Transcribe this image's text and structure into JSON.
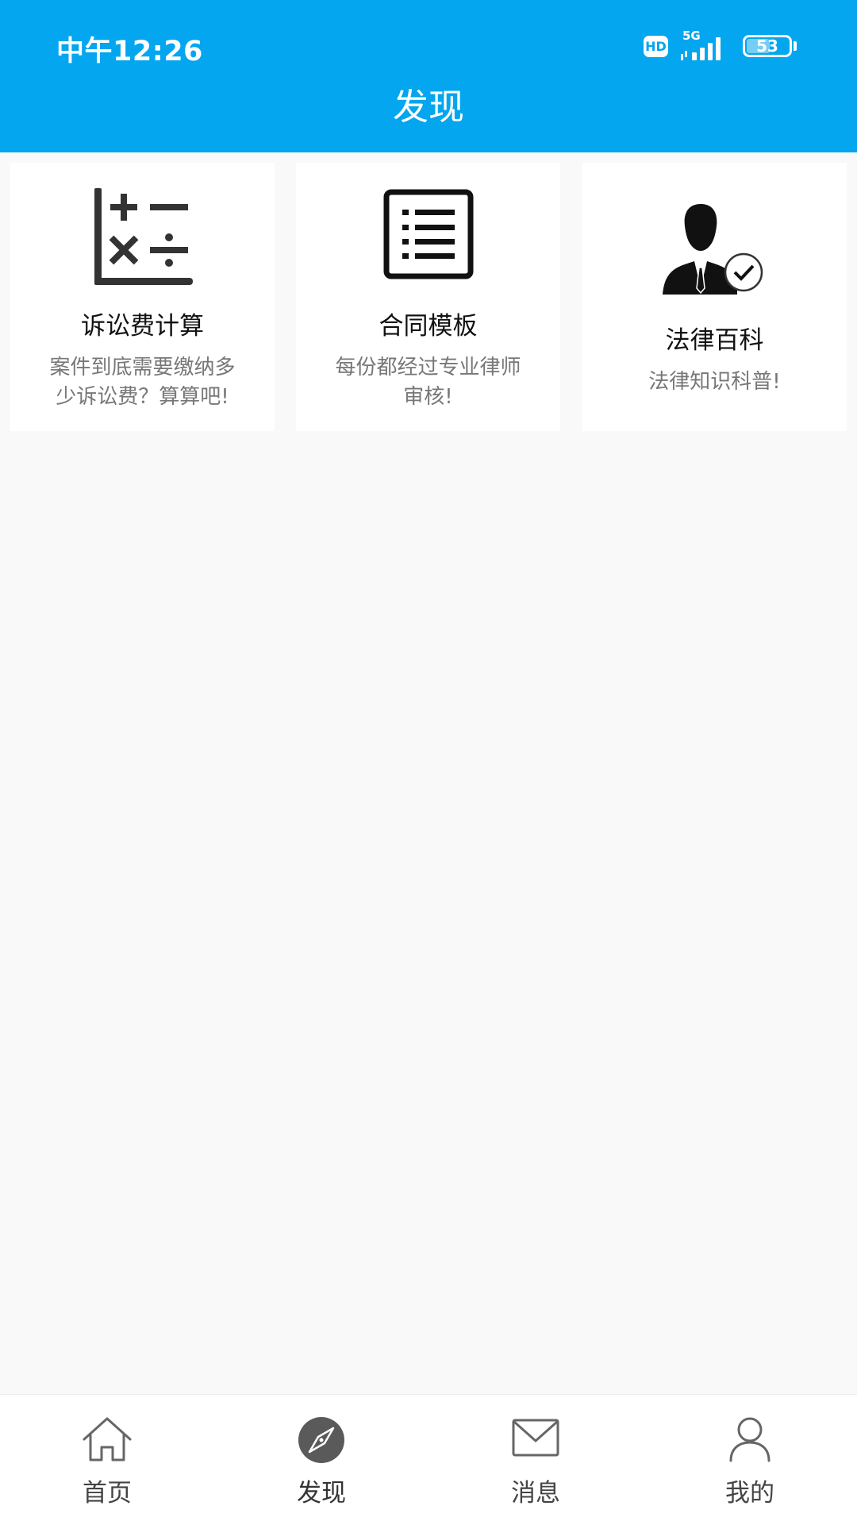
{
  "status_bar": {
    "time": "中午12:26",
    "hd": "HD",
    "network": "5G",
    "battery": "53"
  },
  "header": {
    "title": "发现"
  },
  "cards": [
    {
      "title": "诉讼费计算",
      "desc_line1": "案件到底需要缴纳多",
      "desc_line2": "少诉讼费？算算吧!",
      "icon": "calculator-icon"
    },
    {
      "title": "合同模板",
      "desc_line1": "每份都经过专业律师",
      "desc_line2": "审核!",
      "icon": "list-document-icon"
    },
    {
      "title": "法律百科",
      "desc_line1": "法律知识科普!",
      "desc_line2": "",
      "icon": "lawyer-verified-icon"
    }
  ],
  "tabbar": {
    "items": [
      {
        "label": "首页",
        "icon": "home-icon"
      },
      {
        "label": "发现",
        "icon": "compass-icon",
        "active": true
      },
      {
        "label": "消息",
        "icon": "mail-icon"
      },
      {
        "label": "我的",
        "icon": "user-icon"
      }
    ]
  },
  "colors": {
    "primary": "#03a6ef",
    "background": "#f9f9f9",
    "icon_dark": "#333333"
  }
}
